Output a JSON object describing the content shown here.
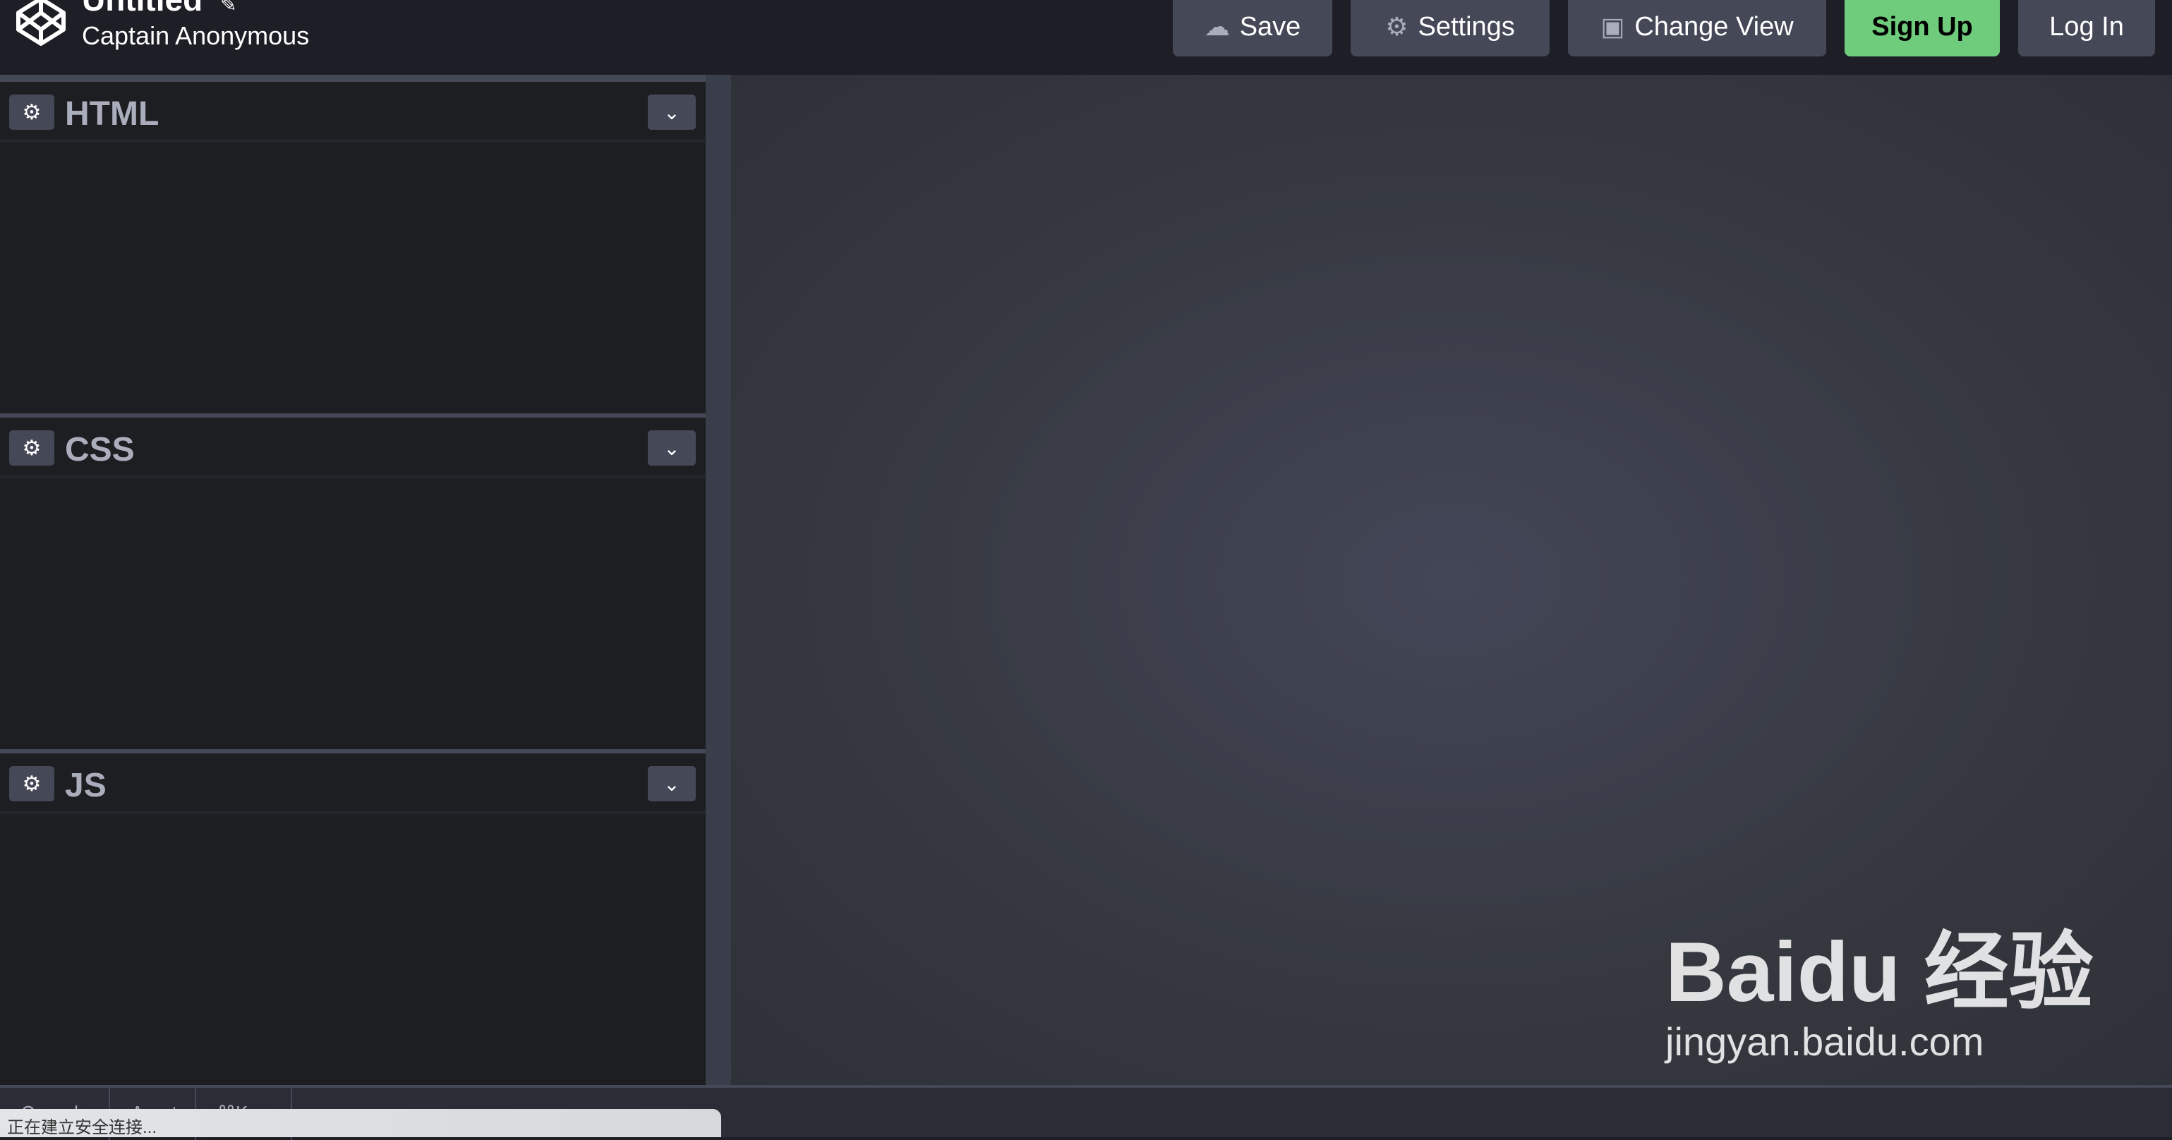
{
  "header": {
    "title": "Untitled",
    "author": "Captain Anonymous",
    "buttons": [
      {
        "label": "Save",
        "icon": "cloud-icon"
      },
      {
        "label": "Settings",
        "icon": "gear-icon"
      },
      {
        "label": "Change View",
        "icon": "view-icon"
      },
      {
        "label": "Sign Up"
      },
      {
        "label": "Log In"
      }
    ]
  },
  "editors": [
    {
      "name": "HTML"
    },
    {
      "name": "CSS"
    },
    {
      "name": "JS"
    }
  ],
  "footer": {
    "tabs": [
      "Console",
      "Assets",
      "⌘K"
    ]
  },
  "toast": {
    "text": "正在建立安全连接..."
  },
  "watermark": {
    "brand": "Bai du 经验",
    "url": "jingyan.baidu.com"
  },
  "colors": {
    "signup": "#6fcc7c",
    "button": "#444857",
    "background": "#1e1f26"
  }
}
